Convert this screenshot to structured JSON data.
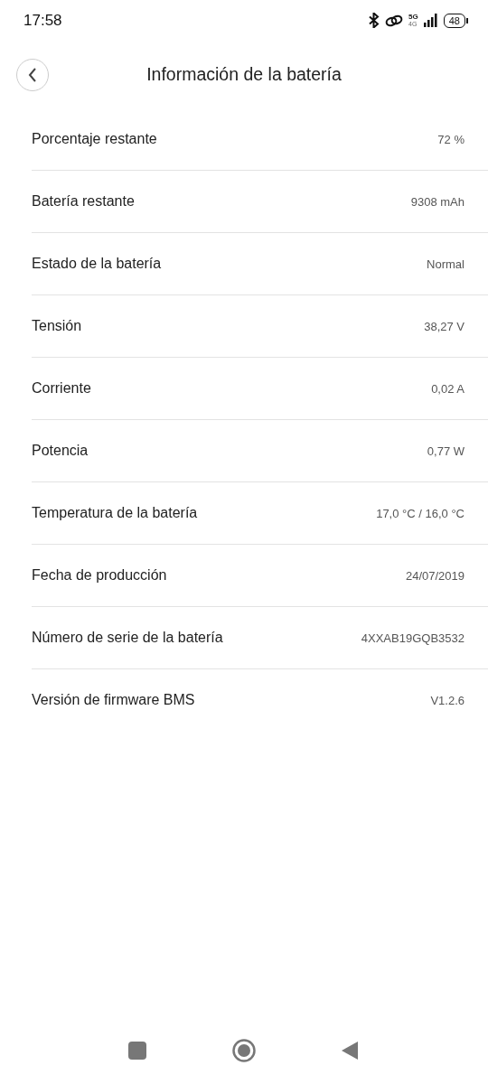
{
  "status_bar": {
    "time": "17:58",
    "network": "5G",
    "network_secondary": "4G",
    "battery": "48"
  },
  "header": {
    "title": "Información de la batería"
  },
  "rows": [
    {
      "label": "Porcentaje restante",
      "value": "72 %"
    },
    {
      "label": "Batería restante",
      "value": "9308 mAh"
    },
    {
      "label": "Estado de la batería",
      "value": "Normal"
    },
    {
      "label": "Tensión",
      "value": "38,27 V"
    },
    {
      "label": "Corriente",
      "value": "0,02 A"
    },
    {
      "label": "Potencia",
      "value": "0,77 W"
    },
    {
      "label": "Temperatura de la batería",
      "value": "17,0 °C / 16,0 °C"
    },
    {
      "label": "Fecha de producción",
      "value": "24/07/2019"
    },
    {
      "label": "Número de serie de la batería",
      "value": "4XXAB19GQB3532"
    },
    {
      "label": "Versión de firmware BMS",
      "value": "V1.2.6"
    }
  ]
}
